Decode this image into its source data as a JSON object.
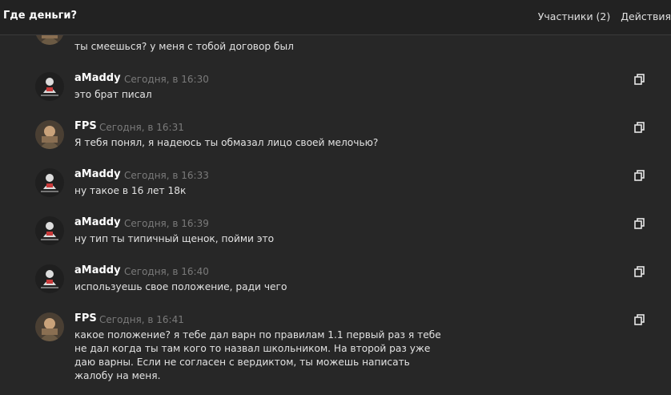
{
  "header": {
    "title": "Где деньги?",
    "participants_label": "Участники (2)",
    "actions_label": "Действия"
  },
  "messages": [
    {
      "author": "",
      "time": "",
      "text": "ты смеешься? у меня с тобой договор был",
      "avatar": "fps-avatar"
    },
    {
      "author": "aMaddy",
      "time": "Сегодня, в 16:30",
      "text": "это брат писал",
      "avatar": "amaddy-avatar"
    },
    {
      "author": "FPS",
      "time": "Сегодня, в 16:31",
      "text": "Я тебя понял, я надеюсь ты обмазал лицо своей мелочью?",
      "avatar": "fps-avatar"
    },
    {
      "author": "aMaddy",
      "time": "Сегодня, в 16:33",
      "text": "ну такое в 16 лет 18к",
      "avatar": "amaddy-avatar"
    },
    {
      "author": "aMaddy",
      "time": "Сегодня, в 16:39",
      "text": "ну тип ты типичный щенок, пойми это",
      "avatar": "amaddy-avatar"
    },
    {
      "author": "aMaddy",
      "time": "Сегодня, в 16:40",
      "text": "используешь свое положение, ради чего",
      "avatar": "amaddy-avatar"
    },
    {
      "author": "FPS",
      "time": "Сегодня, в 16:41",
      "text": "какое положение? я тебе дал варн по правилам 1.1 первый раз я тебе не дал когда ты там кого то назвал школьником. На второй раз уже даю варны. Если не согласен с вердиктом, ты можешь написать жалобу на меня.",
      "avatar": "fps-avatar"
    }
  ],
  "colors": {
    "background": "#272727",
    "header_background": "#222222",
    "time_text": "#7a7a7a"
  }
}
